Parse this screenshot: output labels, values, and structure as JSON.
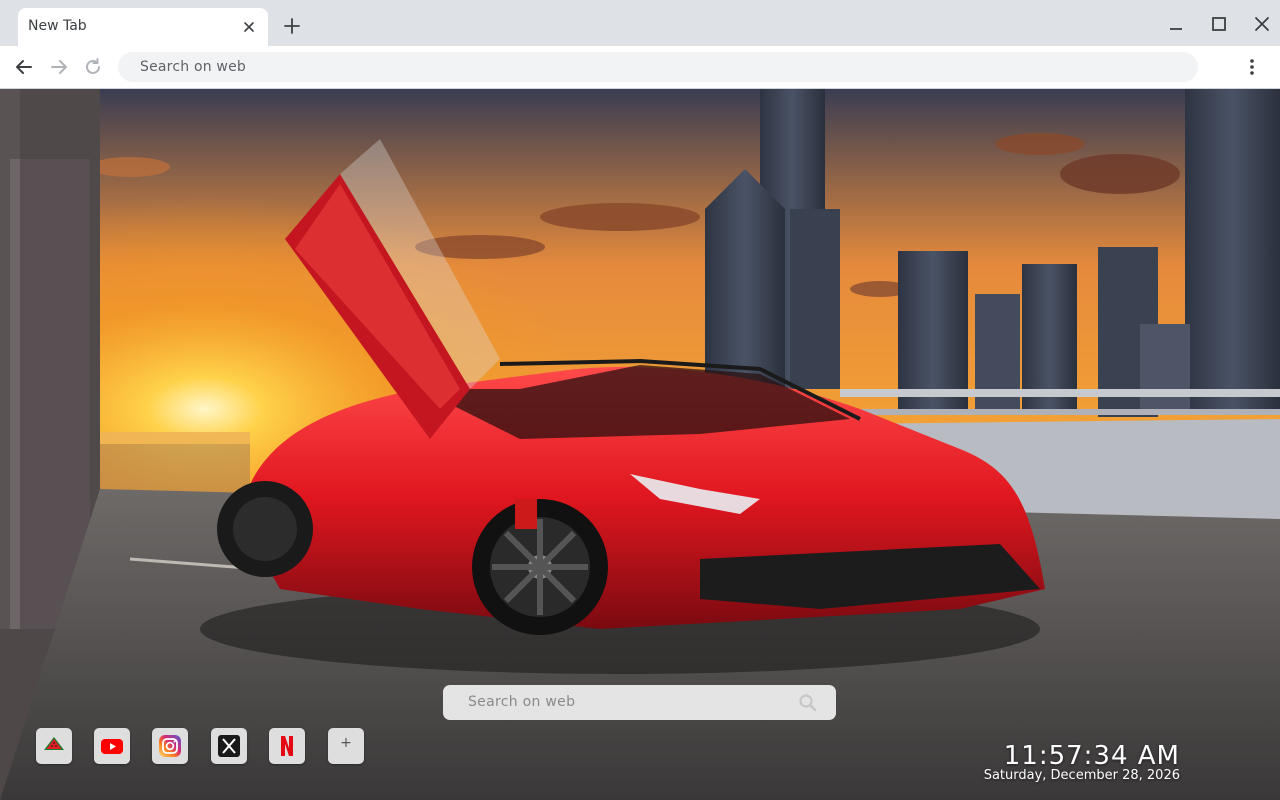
{
  "tab": {
    "title": "New Tab"
  },
  "window_controls": [
    "minimize",
    "maximize",
    "close"
  ],
  "toolbar": {
    "omnibox_placeholder": "Search on web"
  },
  "page": {
    "search": {
      "placeholder": "Search on web"
    },
    "shortcuts": [
      {
        "name": "Watermelon",
        "icon": "watermelon-icon"
      },
      {
        "name": "YouTube",
        "icon": "youtube-icon",
        "color": "#ff0000"
      },
      {
        "name": "Instagram",
        "icon": "instagram-icon",
        "color": "#d6249f"
      },
      {
        "name": "X",
        "icon": "x-icon",
        "color": "#000000"
      },
      {
        "name": "Netflix",
        "icon": "netflix-icon",
        "color": "#e50914"
      },
      {
        "name": "Add shortcut",
        "label": "+",
        "icon": "plus-icon"
      }
    ],
    "clock": {
      "time": "11:57:34 AM",
      "date": "Saturday, December 28, 2026"
    },
    "wallpaper": "red sports car on bridge at sunset with city skyline"
  }
}
